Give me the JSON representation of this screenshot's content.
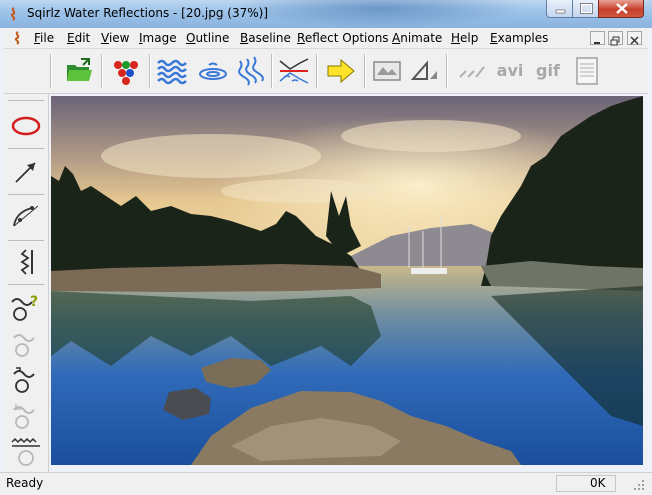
{
  "window": {
    "title": "Sqirlz Water Reflections - [20.jpg  (37%)]",
    "accent_color": "#9cc2e8",
    "close_color": "#c8412c"
  },
  "menu": {
    "items": [
      "File",
      "Edit",
      "View",
      "Image",
      "Outline",
      "Baseline",
      "Reflect Options",
      "Animate",
      "Help",
      "Examples"
    ]
  },
  "toolbar": {
    "buttons": [
      {
        "name": "open-folder-icon"
      },
      {
        "name": "color-palette-icon"
      },
      {
        "name": "waves-icon"
      },
      {
        "name": "ripples-icon"
      },
      {
        "name": "diagonal-waves-icon"
      },
      {
        "name": "reflect-baseline-icon"
      },
      {
        "name": "arrow-right-icon"
      },
      {
        "name": "image-preview-icon"
      },
      {
        "name": "perspective-icon"
      },
      {
        "name": "animation-lines-icon"
      },
      {
        "name": "avi-icon",
        "label": "avi"
      },
      {
        "name": "gif-icon",
        "label": "gif"
      },
      {
        "name": "document-icon"
      }
    ]
  },
  "tools": [
    "ellipse-tool-icon",
    "arrow-tool-icon",
    "curve-tool-icon",
    "zigzag-tool-icon",
    "wave-help-icon",
    "wave-tool-icon",
    "wave-point-icon",
    "wave-undo-icon",
    "water-level-icon"
  ],
  "status": {
    "text": "Ready",
    "right": "0K"
  }
}
